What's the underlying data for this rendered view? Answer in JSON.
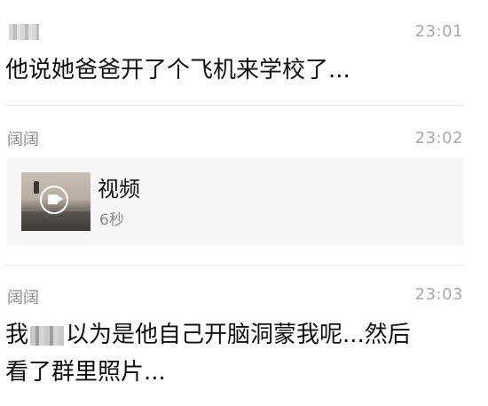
{
  "messages": [
    {
      "sender": "",
      "time": "23:01",
      "text": "他说她爸爸开了个飞机来学校了..."
    },
    {
      "sender": "阔阔",
      "time": "23:02",
      "video": {
        "title": "视频",
        "duration": "6秒",
        "icon": "video-camera-icon"
      }
    },
    {
      "sender": "阔阔",
      "time": "23:03",
      "text_prefix": "我",
      "text_rest": "以为是他自己开脑洞蒙我呢...然后",
      "text_line2": "看了群里照片..."
    }
  ],
  "colors": {
    "sender": "#8a8a8a",
    "time": "#a8a8a8",
    "divider": "#e4e4e4",
    "card_bg": "#f6f6f6"
  }
}
